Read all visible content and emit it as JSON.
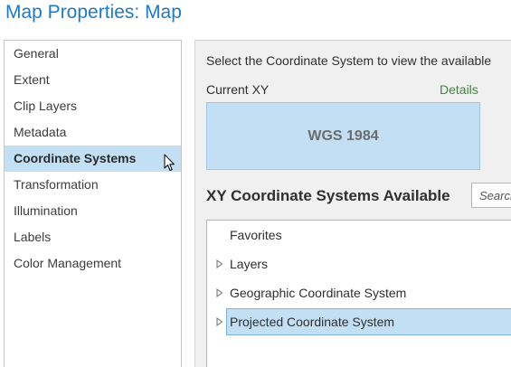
{
  "window": {
    "title": "Map Properties: Map"
  },
  "nav": {
    "items": [
      {
        "label": "General"
      },
      {
        "label": "Extent"
      },
      {
        "label": "Clip Layers"
      },
      {
        "label": "Metadata"
      },
      {
        "label": "Coordinate Systems",
        "selected": true
      },
      {
        "label": "Transformation"
      },
      {
        "label": "Illumination"
      },
      {
        "label": "Labels"
      },
      {
        "label": "Color Management"
      }
    ]
  },
  "content": {
    "intro": "Select the Coordinate System to view the available",
    "current_label": "Current XY",
    "details_link": "Details",
    "current_value": "WGS 1984",
    "available_heading": "XY Coordinate Systems Available",
    "search_placeholder": "Search",
    "tree": [
      {
        "label": "Favorites",
        "expandable": false
      },
      {
        "label": "Layers",
        "expandable": true
      },
      {
        "label": "Geographic Coordinate System",
        "expandable": true
      },
      {
        "label": "Projected Coordinate System",
        "expandable": true,
        "selected": true
      }
    ]
  },
  "colors": {
    "title": "#1d7ac9",
    "selection": "#c3dff4",
    "details_link": "#3a8a3a"
  }
}
